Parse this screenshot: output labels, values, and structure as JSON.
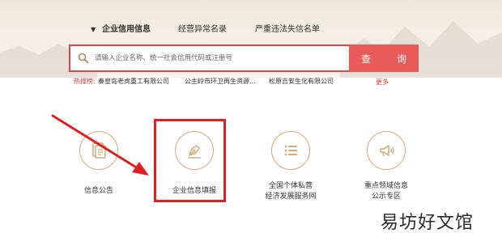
{
  "tabs": [
    {
      "label": "企业信用信息",
      "active": true
    },
    {
      "label": "经营异常名录",
      "active": false
    },
    {
      "label": "严重违法失信名单",
      "active": false
    }
  ],
  "search": {
    "placeholder": "请输入企业名称、统一社会信用代码或注册号",
    "button_label": "查　询"
  },
  "hot": {
    "label": "热搜榜:",
    "links": [
      "秦皇岛老虎重工有限公司",
      "公主岭市环卫再生资源...",
      "松原吉安生化有限公司"
    ],
    "more_label": "更多"
  },
  "services": [
    {
      "label": "信息公告",
      "icon": "document-icon"
    },
    {
      "label": "企业信息填报",
      "icon": "pen-nib-icon"
    },
    {
      "label": "全国个体私营\n经济发展服务网",
      "line1": "全国个体私营",
      "line2": "经济发展服务网",
      "icon": "list-icon"
    },
    {
      "label": "重点领域信息\n公示专区",
      "line1": "重点领域信息",
      "line2": "公示专区",
      "icon": "megaphone-icon"
    }
  ],
  "watermark": "易坊好文馆",
  "colors": {
    "accent_red": "#e95a5a",
    "icon_gold": "#d2ab75",
    "highlight_red": "#e02020"
  }
}
